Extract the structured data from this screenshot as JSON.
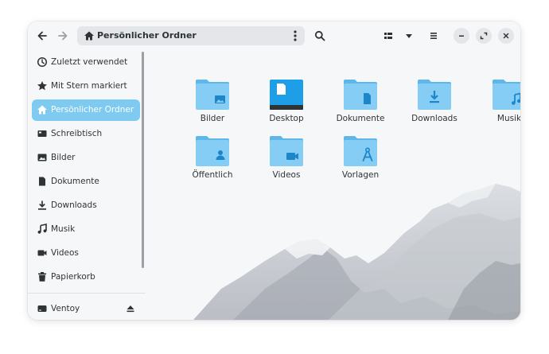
{
  "header": {
    "path_label": "Persönlicher Ordner",
    "back_icon": "go-back-icon",
    "forward_icon": "go-forward-icon",
    "search_icon": "search-icon",
    "view_icon": "view-list-icon",
    "menu_icon": "hamburger-menu-icon"
  },
  "sidebar": {
    "items": [
      {
        "label": "Zuletzt verwendet",
        "icon": "clock-icon"
      },
      {
        "label": "Mit Stern markiert",
        "icon": "star-icon"
      },
      {
        "label": "Persönlicher Ordner",
        "icon": "home-icon"
      },
      {
        "label": "Schreibtisch",
        "icon": "desktop-icon"
      },
      {
        "label": "Bilder",
        "icon": "image-icon"
      },
      {
        "label": "Dokumente",
        "icon": "document-icon"
      },
      {
        "label": "Downloads",
        "icon": "download-icon"
      },
      {
        "label": "Musik",
        "icon": "music-icon"
      },
      {
        "label": "Videos",
        "icon": "video-icon"
      },
      {
        "label": "Papierkorb",
        "icon": "trash-icon"
      },
      {
        "label": "Ventoy",
        "icon": "drive-icon"
      }
    ],
    "active_index": 2
  },
  "folders": [
    {
      "label": "Bilder",
      "icon": "folder-pictures-icon"
    },
    {
      "label": "Desktop",
      "icon": "folder-desktop-icon"
    },
    {
      "label": "Dokumente",
      "icon": "folder-documents-icon"
    },
    {
      "label": "Downloads",
      "icon": "folder-downloads-icon"
    },
    {
      "label": "Musik",
      "icon": "folder-music-icon"
    },
    {
      "label": "Öffentlich",
      "icon": "folder-public-icon"
    },
    {
      "label": "Videos",
      "icon": "folder-videos-icon"
    },
    {
      "label": "Vorlagen",
      "icon": "folder-templates-icon"
    }
  ],
  "colors": {
    "accent": "#7ecaf0",
    "folder_body": "#86cdf5",
    "folder_tab": "#5fb6e8",
    "folder_glyph": "#1c86c9",
    "desktop_folder": "#1e9ee6"
  }
}
